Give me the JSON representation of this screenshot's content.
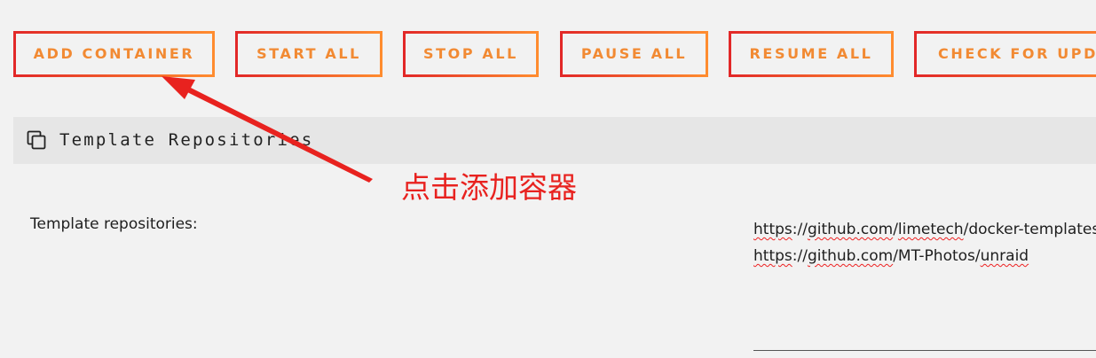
{
  "toolbar": {
    "add_container": "ADD CONTAINER",
    "start_all": "START ALL",
    "stop_all": "STOP ALL",
    "pause_all": "PAUSE ALL",
    "resume_all": "RESUME ALL",
    "check_for_updates": "CHECK FOR UPDATES"
  },
  "section": {
    "title": "Template Repositories",
    "icon": "copy-icon"
  },
  "form": {
    "label": "Template repositories:",
    "repos": [
      {
        "parts": [
          "https",
          "://",
          "github.com",
          "/",
          "limetech",
          "/docker-templates"
        ]
      },
      {
        "parts": [
          "https",
          "://",
          "github.com",
          "/MT-Photos/",
          "unraid",
          ""
        ]
      }
    ]
  },
  "annotation": {
    "text": "点击添加容器",
    "color": "#e8221f"
  },
  "colors": {
    "button_text": "#f28a33",
    "button_border_start": "#e22828",
    "button_border_end": "#ff8c2f",
    "background": "#f2f2f2",
    "header_bg": "#e6e6e6"
  }
}
